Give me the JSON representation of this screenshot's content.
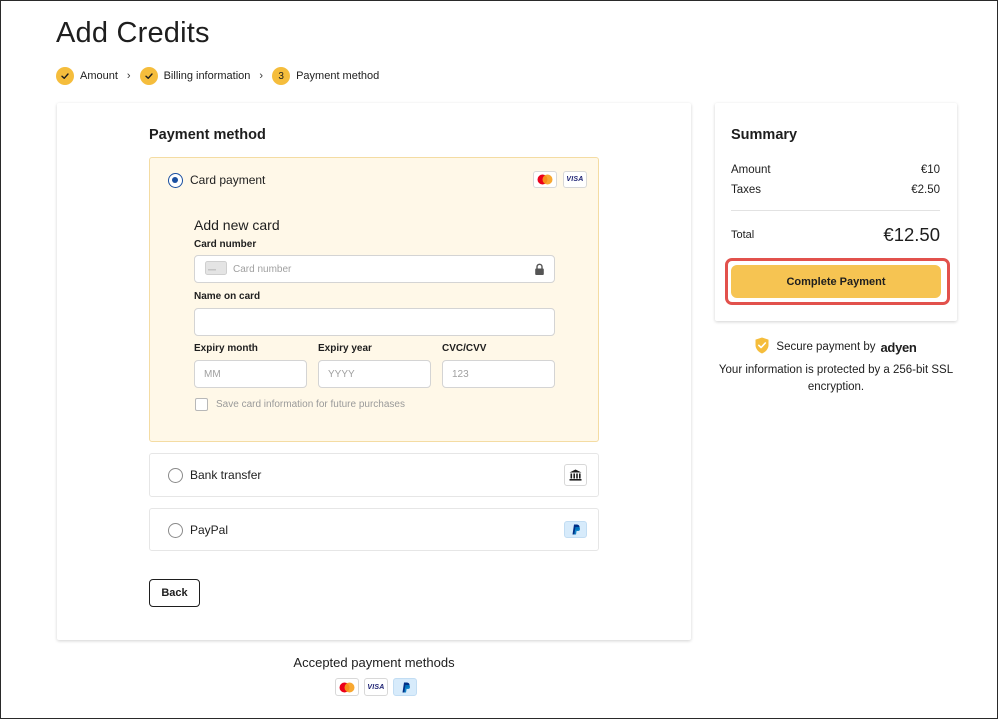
{
  "page": {
    "title": "Add Credits"
  },
  "steps": [
    {
      "label": "Amount",
      "status": "done"
    },
    {
      "label": "Billing information",
      "status": "done"
    },
    {
      "label": "Payment method",
      "status": "current",
      "number": "3"
    }
  ],
  "payment": {
    "section_title": "Payment method",
    "options": [
      {
        "label": "Card payment",
        "selected": true
      },
      {
        "label": "Bank transfer",
        "selected": false
      },
      {
        "label": "PayPal",
        "selected": false
      }
    ],
    "card_form": {
      "title": "Add new card",
      "card_number_label": "Card number",
      "card_number_placeholder": "Card number",
      "name_label": "Name on card",
      "name_value": "",
      "expiry_month_label": "Expiry month",
      "expiry_month_placeholder": "MM",
      "expiry_year_label": "Expiry year",
      "expiry_year_placeholder": "YYYY",
      "cvc_label": "CVC/CVV",
      "cvc_placeholder": "123",
      "save_card_label": "Save card information for future purchases",
      "save_card_checked": false
    },
    "back_label": "Back"
  },
  "summary": {
    "title": "Summary",
    "rows": [
      {
        "label": "Amount",
        "value": "€10"
      },
      {
        "label": "Taxes",
        "value": "€2.50"
      }
    ],
    "total_label": "Total",
    "total_value": "€12.50",
    "complete_label": "Complete Payment"
  },
  "secure": {
    "text": "Secure payment by",
    "brand": "adyen",
    "description": "Your information is protected by a 256-bit SSL encryption."
  },
  "accepted": {
    "title": "Accepted payment methods",
    "visa_text": "VISA"
  },
  "colors": {
    "accent": "#f5bd3c",
    "button": "#f6c452",
    "highlight": "#e2514c",
    "selected_bg": "#fff8e8",
    "radio": "#1a4fa0"
  }
}
